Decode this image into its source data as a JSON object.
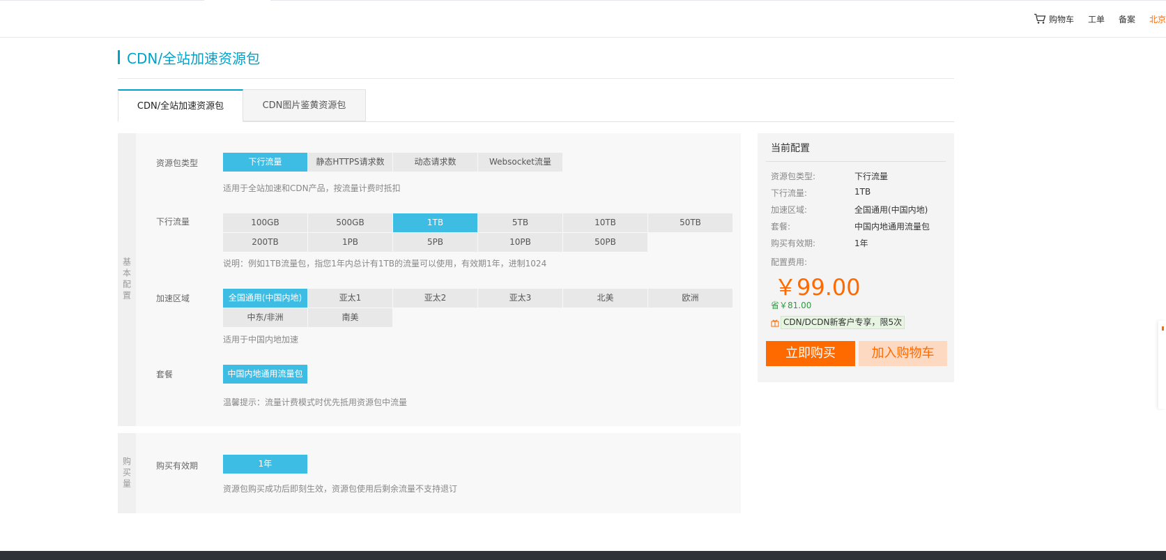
{
  "topnav": {
    "cart": "购物车",
    "ticket": "工单",
    "filing": "备案",
    "region": "北京"
  },
  "page": {
    "title": "CDN/全站加速资源包"
  },
  "tabs": [
    {
      "label": "CDN/全站加速资源包",
      "active": true
    },
    {
      "label": "CDN图片鉴黄资源包",
      "active": false
    }
  ],
  "basic": {
    "side_label": "基本配置",
    "package_type": {
      "label": "资源包类型",
      "options": [
        "下行流量",
        "静态HTTPS请求数",
        "动态请求数",
        "Websocket流量"
      ],
      "selected": "下行流量",
      "hint": "适用于全站加速和CDN产品，按流量计费时抵扣"
    },
    "traffic": {
      "label": "下行流量",
      "options": [
        "100GB",
        "500GB",
        "1TB",
        "5TB",
        "10TB",
        "50TB",
        "200TB",
        "1PB",
        "5PB",
        "10PB",
        "50PB"
      ],
      "selected": "1TB",
      "hint": "说明：例如1TB流量包，指您1年内总计有1TB的流量可以使用，有效期1年，进制1024"
    },
    "region": {
      "label": "加速区域",
      "options": [
        "全国通用(中国内地)",
        "亚太1",
        "亚太2",
        "亚太3",
        "北美",
        "欧洲",
        "中东/非洲",
        "南美"
      ],
      "selected": "全国通用(中国内地)",
      "hint": "适用于中国内地加速"
    },
    "plan": {
      "label": "套餐",
      "options": [
        "中国内地通用流量包"
      ],
      "selected": "中国内地通用流量包",
      "hint": "温馨提示：流量计费模式时优先抵用资源包中流量"
    }
  },
  "buy": {
    "side_label": "购买量",
    "period": {
      "label": "购买有效期",
      "options": [
        "1年"
      ],
      "selected": "1年",
      "hint": "资源包购买成功后即刻生效，资源包使用后剩余流量不支持退订"
    }
  },
  "summary": {
    "title": "当前配置",
    "rows": [
      {
        "key": "资源包类型:",
        "value": "下行流量"
      },
      {
        "key": "下行流量:",
        "value": "1TB"
      },
      {
        "key": "加速区域:",
        "value": "全国通用(中国内地)"
      },
      {
        "key": "套餐:",
        "value": "中国内地通用流量包"
      },
      {
        "key": "购买有效期:",
        "value": "1年"
      }
    ],
    "fee_label": "配置费用:",
    "price": "￥99.00",
    "save": "省￥81.00",
    "promo": "CDN/DCDN新客户专享，限5次",
    "buy_now": "立即购买",
    "add_cart": "加入购物车"
  },
  "colors": {
    "accent": "#00a2ca",
    "selected": "#3ebde4",
    "orange": "#ff6a00",
    "save_green": "#2a9d3e"
  }
}
